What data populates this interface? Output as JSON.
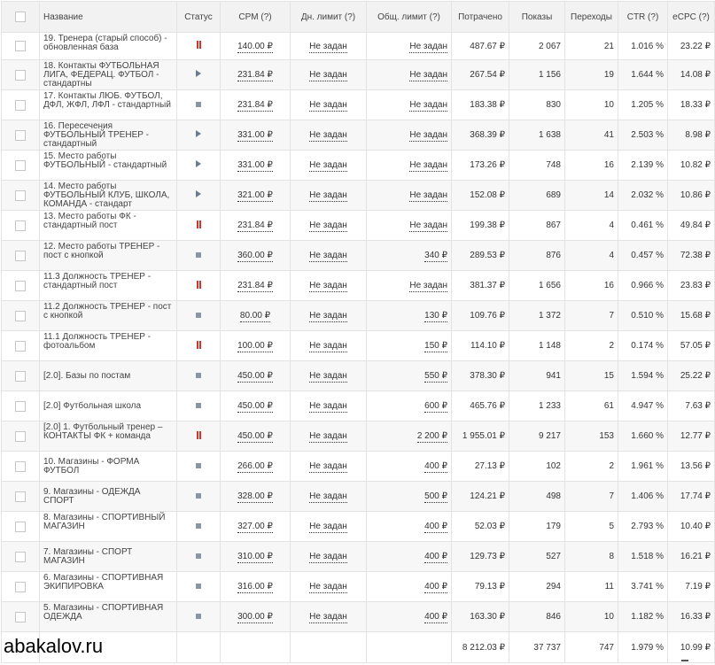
{
  "columns": {
    "name": "Название",
    "status": "Статус",
    "cpm": "CPM (?)",
    "day_limit": "Дн. лимит (?)",
    "total_limit": "Общ. лимит (?)",
    "spent": "Потрачено",
    "impressions": "Показы",
    "clicks": "Переходы",
    "ctr": "CTR (?)",
    "ecpc": "eCPC (?)"
  },
  "status_icons": {
    "paused": "pause-icon",
    "running": "play-icon",
    "stopped": "stop-icon"
  },
  "colors": {
    "paused": "#d0342c",
    "running": "#6a7c91",
    "stopped": "#8a96a6"
  },
  "rows": [
    {
      "name": "19. Тренера (старый способ) - обновленная база",
      "status": "paused",
      "cpm": "140.00 ₽",
      "day_limit": "Не задан",
      "total_limit": "Не задан",
      "spent": "487.67 ₽",
      "impressions": "2 067",
      "clicks": "21",
      "ctr": "1.016 %",
      "ecpc": "23.22 ₽"
    },
    {
      "name": "18. Контакты ФУТБОЛЬНАЯ ЛИГА, ФЕДЕРАЦ. ФУТБОЛ - стандартны",
      "status": "running",
      "cpm": "231.84 ₽",
      "day_limit": "Не задан",
      "total_limit": "Не задан",
      "spent": "267.54 ₽",
      "impressions": "1 156",
      "clicks": "19",
      "ctr": "1.644 %",
      "ecpc": "14.08 ₽"
    },
    {
      "name": "17. Контакты ЛЮБ. ФУТБОЛ, ДФЛ, ЖФЛ, ЛФЛ - стандартный",
      "status": "stopped",
      "cpm": "231.84 ₽",
      "day_limit": "Не задан",
      "total_limit": "Не задан",
      "spent": "183.38 ₽",
      "impressions": "830",
      "clicks": "10",
      "ctr": "1.205 %",
      "ecpc": "18.33 ₽"
    },
    {
      "name": "16. Пересечения ФУТБОЛЬНЫЙ ТРЕНЕР - стандартный",
      "status": "running",
      "cpm": "331.00 ₽",
      "day_limit": "Не задан",
      "total_limit": "Не задан",
      "spent": "368.39 ₽",
      "impressions": "1 638",
      "clicks": "41",
      "ctr": "2.503 %",
      "ecpc": "8.98 ₽"
    },
    {
      "name": "15. Место работы ФУТБОЛЬНЫЙ - стандартный",
      "status": "running",
      "cpm": "331.00 ₽",
      "day_limit": "Не задан",
      "total_limit": "Не задан",
      "spent": "173.26 ₽",
      "impressions": "748",
      "clicks": "16",
      "ctr": "2.139 %",
      "ecpc": "10.82 ₽"
    },
    {
      "name": "14. Место работы ФУТБОЛЬНЫЙ КЛУБ, ШКОЛА, КОМАНДА - стандарт",
      "status": "running",
      "cpm": "321.00 ₽",
      "day_limit": "Не задан",
      "total_limit": "Не задан",
      "spent": "152.08 ₽",
      "impressions": "689",
      "clicks": "14",
      "ctr": "2.032 %",
      "ecpc": "10.86 ₽"
    },
    {
      "name": "13. Место работы ФК - стандартный пост",
      "status": "paused",
      "cpm": "231.84 ₽",
      "day_limit": "Не задан",
      "total_limit": "Не задан",
      "spent": "199.38 ₽",
      "impressions": "867",
      "clicks": "4",
      "ctr": "0.461 %",
      "ecpc": "49.84 ₽"
    },
    {
      "name": "12. Место работы ТРЕНЕР - пост с кнопкой",
      "status": "stopped",
      "cpm": "360.00 ₽",
      "day_limit": "Не задан",
      "total_limit": "340 ₽",
      "spent": "289.53 ₽",
      "impressions": "876",
      "clicks": "4",
      "ctr": "0.457 %",
      "ecpc": "72.38 ₽"
    },
    {
      "name": "11.3 Должность ТРЕНЕР - стандартный пост",
      "status": "paused",
      "cpm": "231.84 ₽",
      "day_limit": "Не задан",
      "total_limit": "Не задан",
      "spent": "381.37 ₽",
      "impressions": "1 656",
      "clicks": "16",
      "ctr": "0.966 %",
      "ecpc": "23.83 ₽"
    },
    {
      "name": "11.2 Должность ТРЕНЕР - пост с кнопкой",
      "status": "stopped",
      "cpm": "80.00 ₽",
      "day_limit": "Не задан",
      "total_limit": "130 ₽",
      "spent": "109.76 ₽",
      "impressions": "1 372",
      "clicks": "7",
      "ctr": "0.510 %",
      "ecpc": "15.68 ₽"
    },
    {
      "name": "11.1 Должность ТРЕНЕР - фотоальбом",
      "status": "paused",
      "cpm": "100.00 ₽",
      "day_limit": "Не задан",
      "total_limit": "150 ₽",
      "spent": "114.10 ₽",
      "impressions": "1 148",
      "clicks": "2",
      "ctr": "0.174 %",
      "ecpc": "57.05 ₽"
    },
    {
      "name": "[2.0]. Базы по постам",
      "status": "stopped",
      "cpm": "450.00 ₽",
      "day_limit": "Не задан",
      "total_limit": "550 ₽",
      "spent": "378.30 ₽",
      "impressions": "941",
      "clicks": "15",
      "ctr": "1.594 %",
      "ecpc": "25.22 ₽"
    },
    {
      "name": "[2.0] Футбольная школа",
      "status": "stopped",
      "cpm": "450.00 ₽",
      "day_limit": "Не задан",
      "total_limit": "600 ₽",
      "spent": "465.76 ₽",
      "impressions": "1 233",
      "clicks": "61",
      "ctr": "4.947 %",
      "ecpc": "7.63 ₽"
    },
    {
      "name": "[2.0] 1. Футбольный тренер – КОНТАКТЫ ФК + команда",
      "status": "paused",
      "cpm": "450.00 ₽",
      "day_limit": "Не задан",
      "total_limit": "2 200 ₽",
      "spent": "1 955.01 ₽",
      "impressions": "9 217",
      "clicks": "153",
      "ctr": "1.660 %",
      "ecpc": "12.77 ₽"
    },
    {
      "name": "10. Магазины - ФОРМА ФУТБОЛ",
      "status": "stopped",
      "cpm": "266.00 ₽",
      "day_limit": "Не задан",
      "total_limit": "400 ₽",
      "spent": "27.13 ₽",
      "impressions": "102",
      "clicks": "2",
      "ctr": "1.961 %",
      "ecpc": "13.56 ₽"
    },
    {
      "name": "9. Магазины - ОДЕЖДА СПОРТ",
      "status": "stopped",
      "cpm": "328.00 ₽",
      "day_limit": "Не задан",
      "total_limit": "500 ₽",
      "spent": "124.21 ₽",
      "impressions": "498",
      "clicks": "7",
      "ctr": "1.406 %",
      "ecpc": "17.74 ₽"
    },
    {
      "name": "8. Магазины - СПОРТИВНЫЙ МАГАЗИН",
      "status": "stopped",
      "cpm": "327.00 ₽",
      "day_limit": "Не задан",
      "total_limit": "400 ₽",
      "spent": "52.03 ₽",
      "impressions": "179",
      "clicks": "5",
      "ctr": "2.793 %",
      "ecpc": "10.40 ₽"
    },
    {
      "name": "7. Магазины - СПОРТ МАГАЗИН",
      "status": "stopped",
      "cpm": "310.00 ₽",
      "day_limit": "Не задан",
      "total_limit": "400 ₽",
      "spent": "129.73 ₽",
      "impressions": "527",
      "clicks": "8",
      "ctr": "1.518 %",
      "ecpc": "16.21 ₽"
    },
    {
      "name": "6. Магазины - СПОРТИВНАЯ ЭКИПИРОВКА",
      "status": "stopped",
      "cpm": "316.00 ₽",
      "day_limit": "Не задан",
      "total_limit": "400 ₽",
      "spent": "79.13 ₽",
      "impressions": "294",
      "clicks": "11",
      "ctr": "3.741 %",
      "ecpc": "7.19 ₽"
    },
    {
      "name": "5. Магазины - СПОРТИВНАЯ ОДЕЖДА",
      "status": "stopped",
      "cpm": "300.00 ₽",
      "day_limit": "Не задан",
      "total_limit": "400 ₽",
      "spent": "163.30 ₽",
      "impressions": "846",
      "clicks": "10",
      "ctr": "1.182 %",
      "ecpc": "16.33 ₽"
    }
  ],
  "totals": {
    "spent": "8 212.03 ₽",
    "impressions": "37 737",
    "clicks": "747",
    "ctr": "1.979 %",
    "ecpc": "10.99 ₽"
  },
  "watermark": "abakalov.ru"
}
